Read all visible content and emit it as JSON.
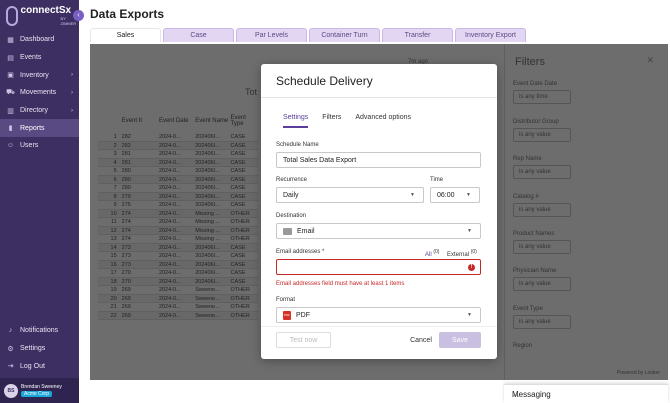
{
  "brand": {
    "name": "connectSx",
    "sub": "BY ZIMMER"
  },
  "sidebar": {
    "items": [
      {
        "label": "Dashboard",
        "icon": "dashboard-icon",
        "chevron": false
      },
      {
        "label": "Events",
        "icon": "calendar-icon",
        "chevron": false
      },
      {
        "label": "Inventory",
        "icon": "box-icon",
        "chevron": true
      },
      {
        "label": "Movements",
        "icon": "truck-icon",
        "chevron": true
      },
      {
        "label": "Directory",
        "icon": "book-icon",
        "chevron": true
      },
      {
        "label": "Reports",
        "icon": "chart-icon",
        "chevron": false,
        "active": true
      },
      {
        "label": "Users",
        "icon": "users-icon",
        "chevron": false
      }
    ],
    "bottom": [
      {
        "label": "Notifications",
        "icon": "bell-icon"
      },
      {
        "label": "Settings",
        "icon": "gear-icon"
      },
      {
        "label": "Log Out",
        "icon": "logout-icon"
      }
    ],
    "user": {
      "initials": "BS",
      "name": "Brendan Sweeney",
      "org": "Acme Corp"
    }
  },
  "page": {
    "title": "Data Exports"
  },
  "tabs": [
    "Sales",
    "Case",
    "Par Levels",
    "Container Turn",
    "Transfer",
    "Inventory Export"
  ],
  "report": {
    "meta": "7m ago",
    "title": "Tot",
    "headers": [
      "",
      "Event It",
      "Event Date",
      "Event Name",
      "Event Type"
    ],
    "rows": [
      [
        "1",
        "282",
        "2024-0...",
        "202406I...",
        "CASE"
      ],
      [
        "2",
        "282",
        "2024-0...",
        "202406I...",
        "CASE"
      ],
      [
        "3",
        "281",
        "2024-0...",
        "202406I...",
        "CASE"
      ],
      [
        "4",
        "281",
        "2024-0...",
        "202406I...",
        "CASE"
      ],
      [
        "5",
        "280",
        "2024-0...",
        "202406I...",
        "CASE"
      ],
      [
        "6",
        "280",
        "2024-0...",
        "202406I...",
        "CASE"
      ],
      [
        "7",
        "280",
        "2024-0...",
        "202406I...",
        "CASE"
      ],
      [
        "8",
        "279",
        "2024-0...",
        "202406I...",
        "CASE"
      ],
      [
        "9",
        "275",
        "2024-0...",
        "202406I...",
        "CASE"
      ],
      [
        "10",
        "274",
        "2024-0...",
        "Missing ...",
        "OTHER"
      ],
      [
        "11",
        "274",
        "2024-0...",
        "Missing ...",
        "OTHER"
      ],
      [
        "12",
        "274",
        "2024-0...",
        "Missing ...",
        "OTHER"
      ],
      [
        "13",
        "274",
        "2024-0...",
        "Missing ...",
        "OTHER"
      ],
      [
        "14",
        "273",
        "2024-0...",
        "202406I...",
        "CASE"
      ],
      [
        "15",
        "273",
        "2024-0...",
        "202406I...",
        "CASE"
      ],
      [
        "16",
        "273",
        "2024-0...",
        "202406I...",
        "CASE"
      ],
      [
        "17",
        "270",
        "2024-0...",
        "202406I...",
        "CASE"
      ],
      [
        "18",
        "270",
        "2024-0...",
        "202406I...",
        "CASE"
      ],
      [
        "19",
        "269",
        "2024-0...",
        "Sweene...",
        "OTHER"
      ],
      [
        "20",
        "269",
        "2024-0...",
        "Sweene...",
        "OTHER"
      ],
      [
        "21",
        "269",
        "2024-0...",
        "Sweene...",
        "OTHER"
      ],
      [
        "22",
        "269",
        "2024-0...",
        "Sweene...",
        "OTHER"
      ]
    ]
  },
  "filters": {
    "title": "Filters",
    "items": [
      {
        "label": "Event Date Date",
        "value": "is any time"
      },
      {
        "label": "Distributor Group",
        "value": "is any value"
      },
      {
        "label": "Rep Name",
        "value": "is any value"
      },
      {
        "label": "Catalog #",
        "value": "is any value"
      },
      {
        "label": "Product Names",
        "value": "is any value"
      },
      {
        "label": "Physician Name",
        "value": "is any value"
      },
      {
        "label": "Event Type",
        "value": "is any value"
      },
      {
        "label": "Region",
        "value": ""
      }
    ],
    "powered": "Powered by Looker"
  },
  "modal": {
    "title": "Schedule Delivery",
    "tabs": [
      "Settings",
      "Filters",
      "Advanced options"
    ],
    "schedule_name_label": "Schedule Name",
    "schedule_name": "Total Sales Data Export",
    "recurrence_label": "Recurrence",
    "recurrence": "Daily",
    "time_label": "Time",
    "time": "06:00",
    "destination_label": "Destination",
    "destination": "Email",
    "email_label": "Email addresses *",
    "email_placeholder": "",
    "all_label": "All",
    "all_count": "(0)",
    "external_label": "External",
    "external_count": "(0)",
    "error": "Email addresses field must have at least 1 items",
    "format_label": "Format",
    "format": "PDF",
    "test_label": "Test now",
    "cancel_label": "Cancel",
    "save_label": "Save"
  },
  "messaging": {
    "label": "Messaging"
  }
}
